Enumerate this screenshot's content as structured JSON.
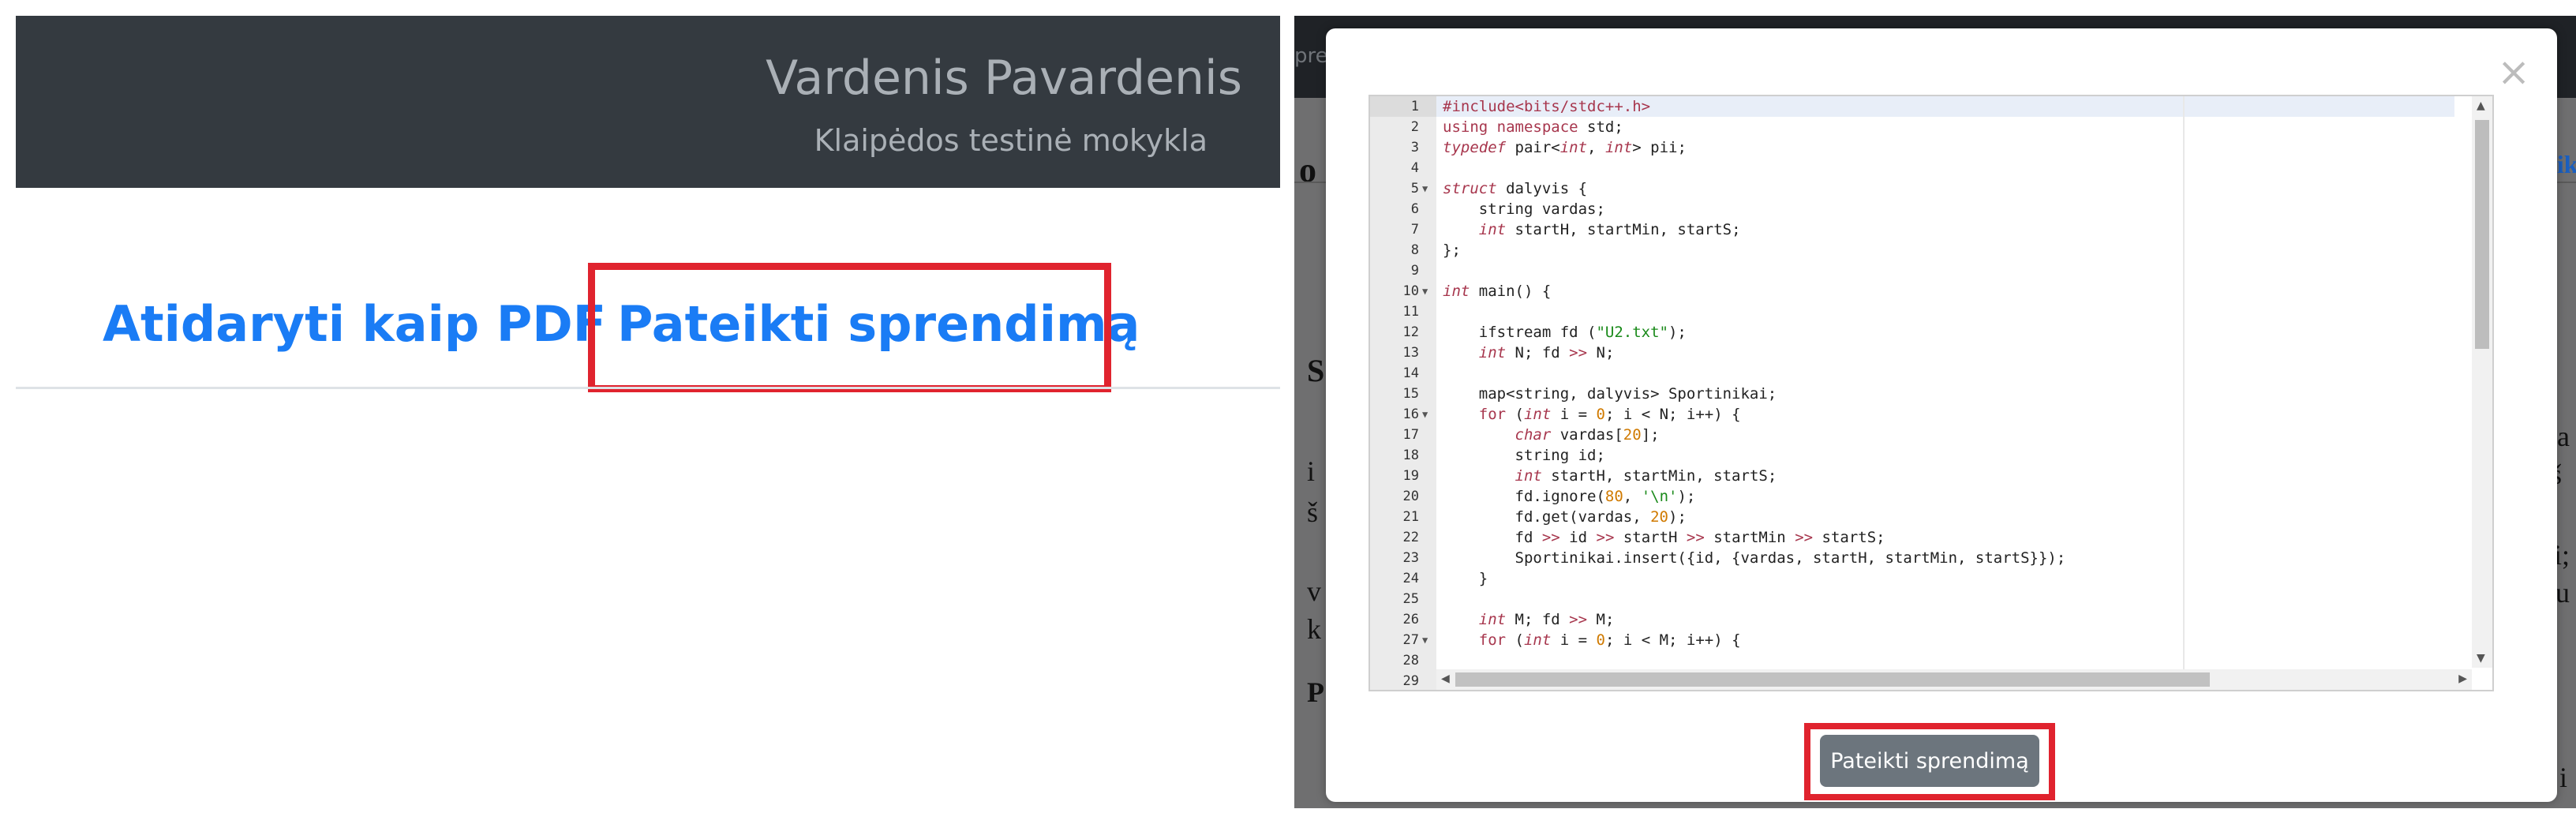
{
  "header": {
    "user_name": "Vardenis Pavardenis",
    "school": "Klaipėdos testinė mokykla"
  },
  "tabs": {
    "pdf_label": "Atidaryti kaip PDF",
    "submit_label": "Pateikti sprendimą"
  },
  "background_page": {
    "header_fragment": "pre",
    "title_fragment": "o",
    "section_letter_s": "S",
    "section_letter_p": "P",
    "line_start_1": "i",
    "line_start_2": "š",
    "line_start_3": "v",
    "line_start_4": "k",
    "right_fragment_link": "teik",
    "right_fragment_1": "va",
    "right_fragment_2": "iš",
    "right_fragment_3": "si;",
    "right_fragment_4": "au",
    "right_fragment_5": ") i"
  },
  "modal": {
    "close_glyph": "×",
    "submit_button": "Pateikti sprendimą"
  },
  "code": [
    {
      "n": "1",
      "fold": false,
      "html": "<span class=\"kp\">#include&lt;bits/stdc++.h&gt;</span>"
    },
    {
      "n": "2",
      "fold": false,
      "html": "<span class=\"kp\">using namespace</span> std;"
    },
    {
      "n": "3",
      "fold": false,
      "html": "<span class=\"kw\">typedef</span> pair&lt;<span class=\"kw\">int</span>, <span class=\"kw\">int</span>&gt; pii;"
    },
    {
      "n": "4",
      "fold": false,
      "html": ""
    },
    {
      "n": "5",
      "fold": true,
      "html": "<span class=\"kw\">struct</span> dalyvis {"
    },
    {
      "n": "6",
      "fold": false,
      "html": "    string vardas;"
    },
    {
      "n": "7",
      "fold": false,
      "html": "    <span class=\"kw\">int</span> startH, startMin, startS;"
    },
    {
      "n": "8",
      "fold": false,
      "html": "};"
    },
    {
      "n": "9",
      "fold": false,
      "html": ""
    },
    {
      "n": "10",
      "fold": true,
      "html": "<span class=\"kw\">int</span> main() {"
    },
    {
      "n": "11",
      "fold": false,
      "html": ""
    },
    {
      "n": "12",
      "fold": false,
      "html": "    ifstream fd (<span class=\"str\">\"U2.txt\"</span>);"
    },
    {
      "n": "13",
      "fold": false,
      "html": "    <span class=\"kw\">int</span> N; fd <span class=\"kp\">&gt;&gt;</span> N;"
    },
    {
      "n": "14",
      "fold": false,
      "html": ""
    },
    {
      "n": "15",
      "fold": false,
      "html": "    map&lt;string, dalyvis&gt; Sportinikai;"
    },
    {
      "n": "16",
      "fold": true,
      "html": "    <span class=\"kp\">for</span> (<span class=\"kw\">int</span> i = <span class=\"num\">0</span>; i &lt; N; i++) {"
    },
    {
      "n": "17",
      "fold": false,
      "html": "        <span class=\"kw\">char</span> vardas[<span class=\"num\">20</span>];"
    },
    {
      "n": "18",
      "fold": false,
      "html": "        string id;"
    },
    {
      "n": "19",
      "fold": false,
      "html": "        <span class=\"kw\">int</span> startH, startMin, startS;"
    },
    {
      "n": "20",
      "fold": false,
      "html": "        fd.ignore(<span class=\"num\">80</span>, <span class=\"str\">'\\n'</span>);"
    },
    {
      "n": "21",
      "fold": false,
      "html": "        fd.get(vardas, <span class=\"num\">20</span>);"
    },
    {
      "n": "22",
      "fold": false,
      "html": "        fd <span class=\"kp\">&gt;&gt;</span> id <span class=\"kp\">&gt;&gt;</span> startH <span class=\"kp\">&gt;&gt;</span> startMin <span class=\"kp\">&gt;&gt;</span> startS;"
    },
    {
      "n": "23",
      "fold": false,
      "html": "        Sportinikai.insert({id, {vardas, startH, startMin, startS}});"
    },
    {
      "n": "24",
      "fold": false,
      "html": "    }"
    },
    {
      "n": "25",
      "fold": false,
      "html": ""
    },
    {
      "n": "26",
      "fold": false,
      "html": "    <span class=\"kw\">int</span> M; fd <span class=\"kp\">&gt;&gt;</span> M;"
    },
    {
      "n": "27",
      "fold": true,
      "html": "    <span class=\"kp\">for</span> (<span class=\"kw\">int</span> i = <span class=\"num\">0</span>; i &lt; M; i++) {"
    },
    {
      "n": "28",
      "fold": false,
      "html": ""
    },
    {
      "n": "29",
      "fold": false,
      "html": ""
    }
  ]
}
